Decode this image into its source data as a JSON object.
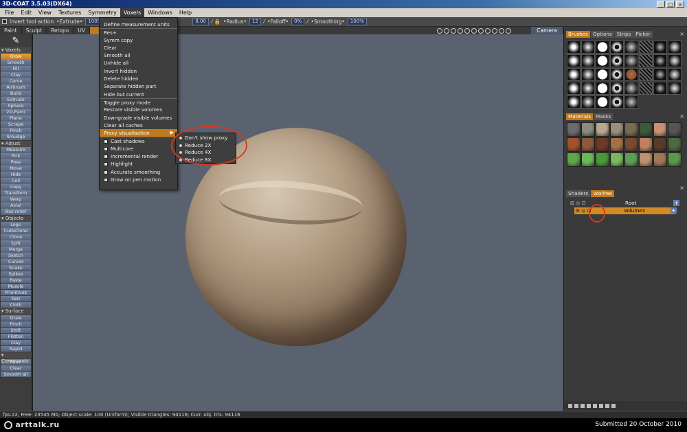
{
  "window": {
    "title": "3D-COAT 3.5.03(DX64)"
  },
  "menubar": [
    "File",
    "Edit",
    "View",
    "Textures",
    "Symmetry",
    "Voxels",
    "Windows",
    "Help"
  ],
  "toolbar": {
    "invert_label": "Invert tool action",
    "extrude_label": "•Extrude•",
    "extrude_value": "100%",
    "depth_value": "8.00",
    "radius_label": "•Radius•",
    "radius_value": "12",
    "falloff_label": "•Falloff•",
    "falloff_value": "0%",
    "smoothing_label": "•Smoothing•",
    "smoothing_value": "100%"
  },
  "rooms": [
    "Paint",
    "Sculpt",
    "Retopo",
    "UV"
  ],
  "camera_label": "Camera",
  "left_panel": {
    "sections": [
      {
        "title": "Voxels",
        "tools": [
          "Grow",
          "Smooth",
          "Fill",
          "Clay",
          "Carve",
          "Airbrush",
          "Build",
          "Extrude",
          "Sphere",
          "2D-Paint",
          "Plane",
          "Scrape",
          "Pinch",
          "Smudge"
        ]
      },
      {
        "title": "Adjust",
        "tools": [
          "Measure",
          "Pick",
          "Pose",
          "Move",
          "Hide",
          "Cell",
          "Copy",
          "Transform",
          "Warp",
          "Axial",
          "Bas-relief"
        ]
      },
      {
        "title": "Objects",
        "tools": [
          "Logo",
          "Cut&Clone",
          "Clone",
          "Split",
          "Merge",
          "Sketch",
          "Curves",
          "Snake",
          "Spikes",
          "Paste",
          "Muscle",
          "Primitives",
          "Text",
          "Cloth"
        ]
      },
      {
        "title": "Surface",
        "tools": [
          "Draw",
          "Pinch",
          "Shift",
          "Flatten",
          "Clay",
          "Rapid"
        ]
      },
      {
        "title": "Commands",
        "tools": [
          "Res+",
          "Clear",
          "Smooth all"
        ]
      }
    ],
    "active_tool": "Grow"
  },
  "voxels_menu": {
    "items": [
      "Define measurement units",
      "Res+",
      "Symm copy",
      "Clear",
      "Smooth all",
      "Unhide all",
      "Invert hidden",
      "Delete hidden",
      "Separate hidden part",
      "Hide but current",
      "Toggle proxy mode",
      "Restore visible volumes",
      "Downgrade visible volumes",
      "Clear all caches",
      "Proxy visualisation"
    ],
    "checks": [
      "Cast shadows",
      "Multicore",
      "Incremental render",
      "Highlight",
      "Accurate smoothing",
      "Grow on pen motion"
    ],
    "highlighted": "Proxy visualisation"
  },
  "proxy_submenu": [
    "Don't show proxy",
    "Reduce 2X",
    "Reduce 4X",
    "Reduce 8X"
  ],
  "right_panel": {
    "top_tabs": [
      "Brushes",
      "Options",
      "Strips",
      "Picker"
    ],
    "mid_tabs": [
      "Materials",
      "Masks"
    ],
    "tree_tabs": [
      "Shaders",
      "VoxTree"
    ],
    "tree": {
      "root": "Root",
      "volume": "Volume1"
    }
  },
  "status": "fps:22;     Free: 23545 Mb; Object scale: 100 (Uniform); Visible triangles: 94116; Curr. obj. tris: 94116",
  "footer": {
    "logo": "arttalk.ru",
    "submitted": "Submitted 20 October 2010"
  },
  "colors": {
    "accent": "#c07a1c",
    "tool_blue": "#5f6e88",
    "viewport": "#5a6270",
    "highlight_circle": "#d23a1e"
  }
}
